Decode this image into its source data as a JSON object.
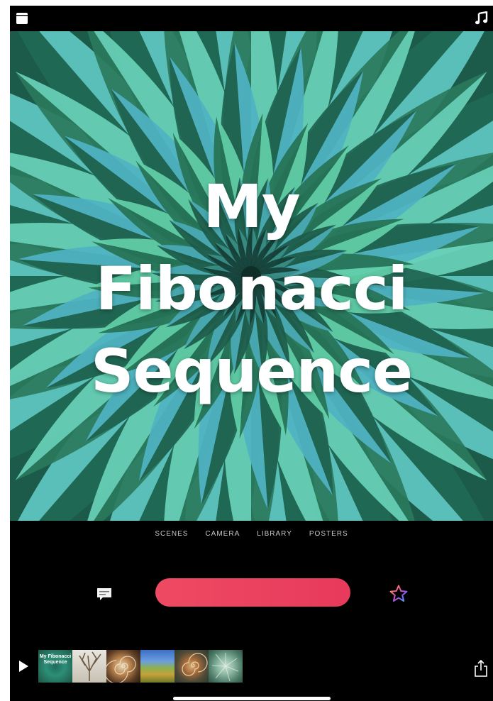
{
  "preview": {
    "title_lines": [
      "My",
      "Fibonacci",
      "Sequence"
    ]
  },
  "tabs": [
    {
      "label": "SCENES"
    },
    {
      "label": "CAMERA"
    },
    {
      "label": "LIBRARY"
    },
    {
      "label": "POSTERS"
    }
  ],
  "timeline": {
    "thumbnails": [
      {
        "label": "My Fibonacci Sequence",
        "kind": "title-card"
      },
      {
        "label": "",
        "kind": "tree"
      },
      {
        "label": "",
        "kind": "shell"
      },
      {
        "label": "",
        "kind": "landscape"
      },
      {
        "label": "",
        "kind": "snail"
      },
      {
        "label": "",
        "kind": "succulent"
      }
    ]
  },
  "icons": {
    "top_left": "layout-icon",
    "top_right": "music-note-icon",
    "caption": "caption-bubble-icon",
    "star": "star-icon",
    "play": "play-icon",
    "share": "share-icon"
  },
  "colors": {
    "record": "#ec4360",
    "background": "#000000",
    "title_text": "#ffffff"
  }
}
